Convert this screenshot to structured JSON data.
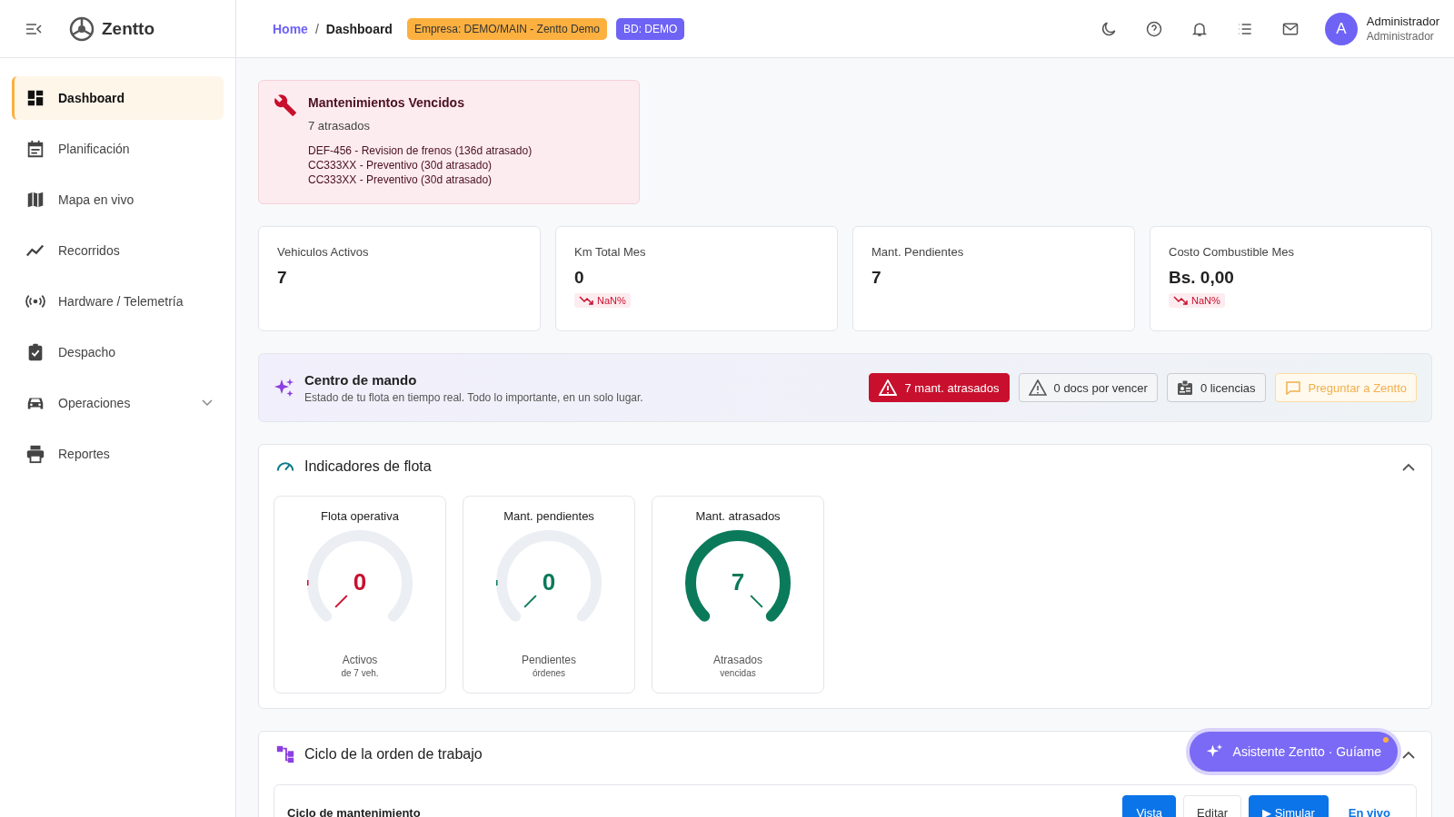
{
  "sidebar": {
    "brand": "Zentto",
    "items": [
      {
        "label": "Dashboard",
        "selected": true
      },
      {
        "label": "Planificación",
        "selected": false
      },
      {
        "label": "Mapa en vivo",
        "selected": false
      },
      {
        "label": "Recorridos",
        "selected": false
      },
      {
        "label": "Hardware / Telemetría",
        "selected": false
      },
      {
        "label": "Despacho",
        "selected": false
      },
      {
        "label": "Operaciones",
        "selected": false,
        "kind": "group",
        "expanded": false
      },
      {
        "label": "Reportes",
        "selected": false
      }
    ]
  },
  "header": {
    "breadcrumb": [
      "Home",
      "Dashboard"
    ],
    "breadcrumb_separator": "/",
    "badges": [
      {
        "label": "Empresa: DEMO/MAIN - Zentto Demo",
        "color": "#fbb040"
      },
      {
        "label": "BD: DEMO",
        "color": "#6e63f5"
      }
    ],
    "user": {
      "initial": "A",
      "name": "Administrador",
      "role": "Administrador"
    }
  },
  "alert": {
    "title": "Mantenimientos Vencidos",
    "count": "7 atrasados",
    "lines": [
      "DEF-456 - Revision de frenos (136d atrasado)",
      "CC333XX - Preventivo (30d atrasado)",
      "CC333XX - Preventivo (30d atrasado)"
    ]
  },
  "kpis": [
    {
      "label": "Vehiculos Activos",
      "value": "7"
    },
    {
      "label": "Km Total Mes",
      "value": "0",
      "trend": "NaN%"
    },
    {
      "label": "Mant. Pendientes",
      "value": "7"
    },
    {
      "label": "Costo Combustible Mes",
      "value": "Bs. 0,00",
      "trend": "NaN%"
    }
  ],
  "command_center": {
    "title": "Centro de mando",
    "subtitle": "Estado de tu flota en tiempo real. Todo lo importante, en un solo lugar.",
    "chips": [
      {
        "label": "7 mant. atrasados",
        "kind": "danger"
      },
      {
        "label": "0 docs por vencer",
        "kind": "warning"
      },
      {
        "label": "0 licencias",
        "kind": "license"
      },
      {
        "label": "Preguntar a Zentto",
        "kind": "ask"
      }
    ]
  },
  "indicators": {
    "title": "Indicadores de flota",
    "expanded": true,
    "gauges": [
      {
        "title": "Flota operativa",
        "value": "0",
        "level": 0,
        "color": "#c8102e",
        "label": "Activos",
        "note": "de 7 veh."
      },
      {
        "title": "Mant. pendientes",
        "value": "0",
        "level": 0,
        "color": "#0b7a5a",
        "label": "Pendientes",
        "note": "órdenes"
      },
      {
        "title": "Mant. atrasados",
        "value": "7",
        "level": 1,
        "color": "#0b7a5a",
        "label": "Atrasados",
        "note": "vencidas"
      }
    ]
  },
  "work_order_cycle": {
    "title": "Ciclo de la orden de trabajo",
    "expanded": true,
    "card_title": "Ciclo de mantenimiento",
    "buttons": [
      {
        "label": "Vista",
        "kind": "toggle",
        "selected": true
      },
      {
        "label": "Editar",
        "kind": "toggle",
        "selected": false
      },
      {
        "label": "▶ Simular",
        "kind": "action"
      },
      {
        "label": "En vivo",
        "kind": "live"
      }
    ]
  },
  "assistant": {
    "label": "Asistente Zentto · Guíame"
  }
}
